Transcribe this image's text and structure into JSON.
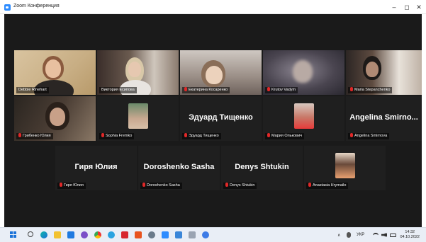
{
  "window": {
    "title": "Zoom Конференция",
    "minimize_glyph": "–",
    "maximize_glyph": "◻",
    "close_glyph": "✕"
  },
  "participants": [
    {
      "name": "Debbie Rinehart",
      "video": "beige",
      "active": true,
      "muted": false
    },
    {
      "name": "Виктория Есипова",
      "video": "room",
      "active": false,
      "muted": false
    },
    {
      "name": "Екатерина Косаренко",
      "video": "sofa",
      "active": false,
      "muted": true
    },
    {
      "name": "Krutov Vadym",
      "video": "blur",
      "active": false,
      "muted": true
    },
    {
      "name": "Maria Stepanchenko",
      "video": "window",
      "active": false,
      "muted": true
    },
    {
      "name": "Грибенко Юлия",
      "video": "dark",
      "active": false,
      "muted": true
    },
    {
      "name": "Sophia Fremko",
      "video": "thumb",
      "active": false,
      "muted": true
    },
    {
      "name": "Эдуард Тищенко",
      "video": "none",
      "big_label": "Эдуард Тищенко",
      "active": false,
      "muted": true
    },
    {
      "name": "Мария Олькович",
      "video": "thumb",
      "active": false,
      "muted": true
    },
    {
      "name": "Angelina Smirnova",
      "video": "none",
      "big_label": "Angelina Smirno...",
      "active": false,
      "muted": true
    },
    {
      "name": "Гиря Юлия",
      "video": "none",
      "big_label": "Гиря Юлия",
      "active": false,
      "muted": true
    },
    {
      "name": "Doroshenko Sasha",
      "video": "none",
      "big_label": "Doroshenko Sasha",
      "active": false,
      "muted": true
    },
    {
      "name": "Denys Shtukin",
      "video": "none",
      "big_label": "Denys Shtukin",
      "active": false,
      "muted": true
    },
    {
      "name": "Anastasia Hrymailo",
      "video": "thumb",
      "active": false,
      "muted": true
    }
  ],
  "taskbar": {
    "icons": [
      "windows-start-icon",
      "search-icon",
      "edge-icon",
      "file-explorer-icon",
      "teams-icon",
      "viber-icon",
      "chrome-icon",
      "telegram-icon",
      "acrobat-icon",
      "office-icon",
      "settings-icon",
      "zoom-icon",
      "photos-icon",
      "word-icon",
      "store-icon"
    ],
    "tray": {
      "chevron": "∧",
      "language": "УКР",
      "time": "14:32",
      "date": "04.10.2022"
    }
  },
  "colors": {
    "meeting_bg": "#1a1a1a",
    "active_speaker": "#d6e04a",
    "mute": "#e02828",
    "taskbar_bg": "#e9eef6",
    "zoom_blue": "#2d8cff"
  }
}
